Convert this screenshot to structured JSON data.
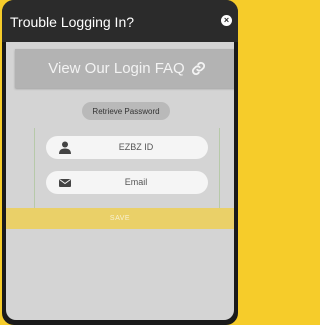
{
  "dialog": {
    "title": "Trouble Logging In?",
    "close_glyph": "×"
  },
  "faq_button": {
    "label": "View Our Login FAQ",
    "icon": "link-icon"
  },
  "retrieve_button": {
    "label": "Retrieve Password"
  },
  "form": {
    "ezbz_id": {
      "placeholder": "EZBZ ID",
      "icon": "user-icon"
    },
    "email": {
      "placeholder": "Email",
      "icon": "envelope-icon"
    }
  },
  "save_button": {
    "label": "SAVE"
  },
  "colors": {
    "background": "#f6cc2a",
    "header": "#2b2b2b",
    "panel": "#d4d4d4",
    "faq_button": "#b3b3b3",
    "save_bar": "#ead068"
  }
}
